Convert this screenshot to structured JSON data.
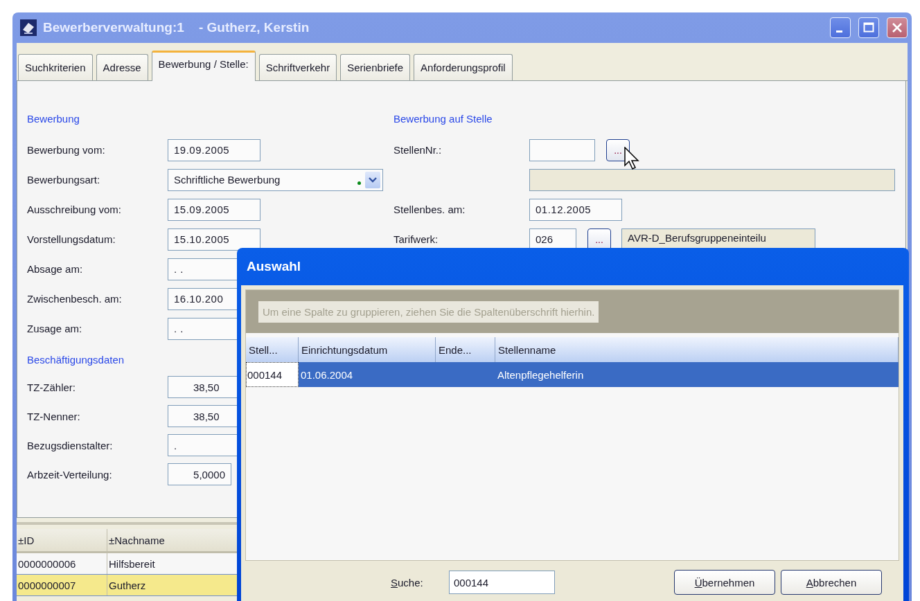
{
  "window": {
    "title": "Bewerberverwaltung:1    - Gutherz, Kerstin"
  },
  "tabs": [
    {
      "label": "Suchkriterien",
      "selected": false
    },
    {
      "label": "Adresse",
      "selected": false
    },
    {
      "label": "Bewerbung / Stelle:",
      "selected": true
    },
    {
      "label": "Schriftverkehr",
      "selected": false
    },
    {
      "label": "Serienbriefe",
      "selected": false
    },
    {
      "label": "Anforderungsprofil",
      "selected": false
    }
  ],
  "application": {
    "heading": "Bewerbung",
    "rows": [
      {
        "kind": "date",
        "label": "Bewerbung vom:",
        "value": "19.09.2005"
      },
      {
        "kind": "combo",
        "label": "Bewerbungsart:",
        "value": "Schriftliche Bewerbung"
      },
      {
        "kind": "date",
        "label": "Ausschreibung vom:",
        "value": "15.09.2005"
      },
      {
        "kind": "date",
        "label": "Vorstellungsdatum:",
        "value": "15.10.2005"
      },
      {
        "kind": "date",
        "label": "Absage am:",
        "value": ". ."
      },
      {
        "kind": "date",
        "label": "Zwischenbesch. am:",
        "value": "16.10.200"
      },
      {
        "kind": "date",
        "label": "Zusage am:",
        "value": ". ."
      }
    ]
  },
  "employment": {
    "heading": "Beschäftigungsdaten",
    "rows": [
      {
        "kind": "number",
        "label": "TZ-Zähler:",
        "value": "38,50"
      },
      {
        "kind": "number",
        "label": "TZ-Nenner:",
        "value": "38,50"
      },
      {
        "kind": "date",
        "label": "Bezugsdienstalter:",
        "value": "."
      },
      {
        "kind": "short",
        "label": "Arbzeit-Verteilung:",
        "value": "5,0000"
      }
    ]
  },
  "position": {
    "heading": "Bewerbung auf Stelle",
    "rows": [
      {
        "kind": "lookup",
        "label": "StellenNr.:",
        "button": "..."
      },
      {
        "kind": "readonly"
      },
      {
        "kind": "date",
        "label": "Stellenbes. am:",
        "value": "01.12.2005"
      },
      {
        "kind": "lookup",
        "label": "Tarifwerk:",
        "value": "026",
        "button": "...",
        "description": "AVR-D_Berufsgruppeneinteilu"
      }
    ]
  },
  "list": {
    "columns": [
      "±ID",
      "±Nachname"
    ],
    "rows": [
      {
        "cells": [
          "0000000006",
          "Hilfsbereit"
        ],
        "selected": false
      },
      {
        "cells": [
          "0000000007",
          "Gutherz"
        ],
        "selected": true
      }
    ]
  },
  "dialog": {
    "title": "Auswahl",
    "group_hint": "Um eine Spalte zu gruppieren, ziehen Sie die Spaltenüberschrift hierhin.",
    "columns": [
      "Stell...",
      "Einrichtungsdatum",
      "Ende...",
      "Stellenname"
    ],
    "rows": [
      {
        "cells": [
          "000144",
          "01.06.2004",
          null,
          "Altenpflegehelferin"
        ],
        "selected": true
      }
    ],
    "search": {
      "label": "Suche:",
      "value": "000144"
    },
    "buttons": [
      "Übernehmen",
      "Abbrechen"
    ]
  }
}
